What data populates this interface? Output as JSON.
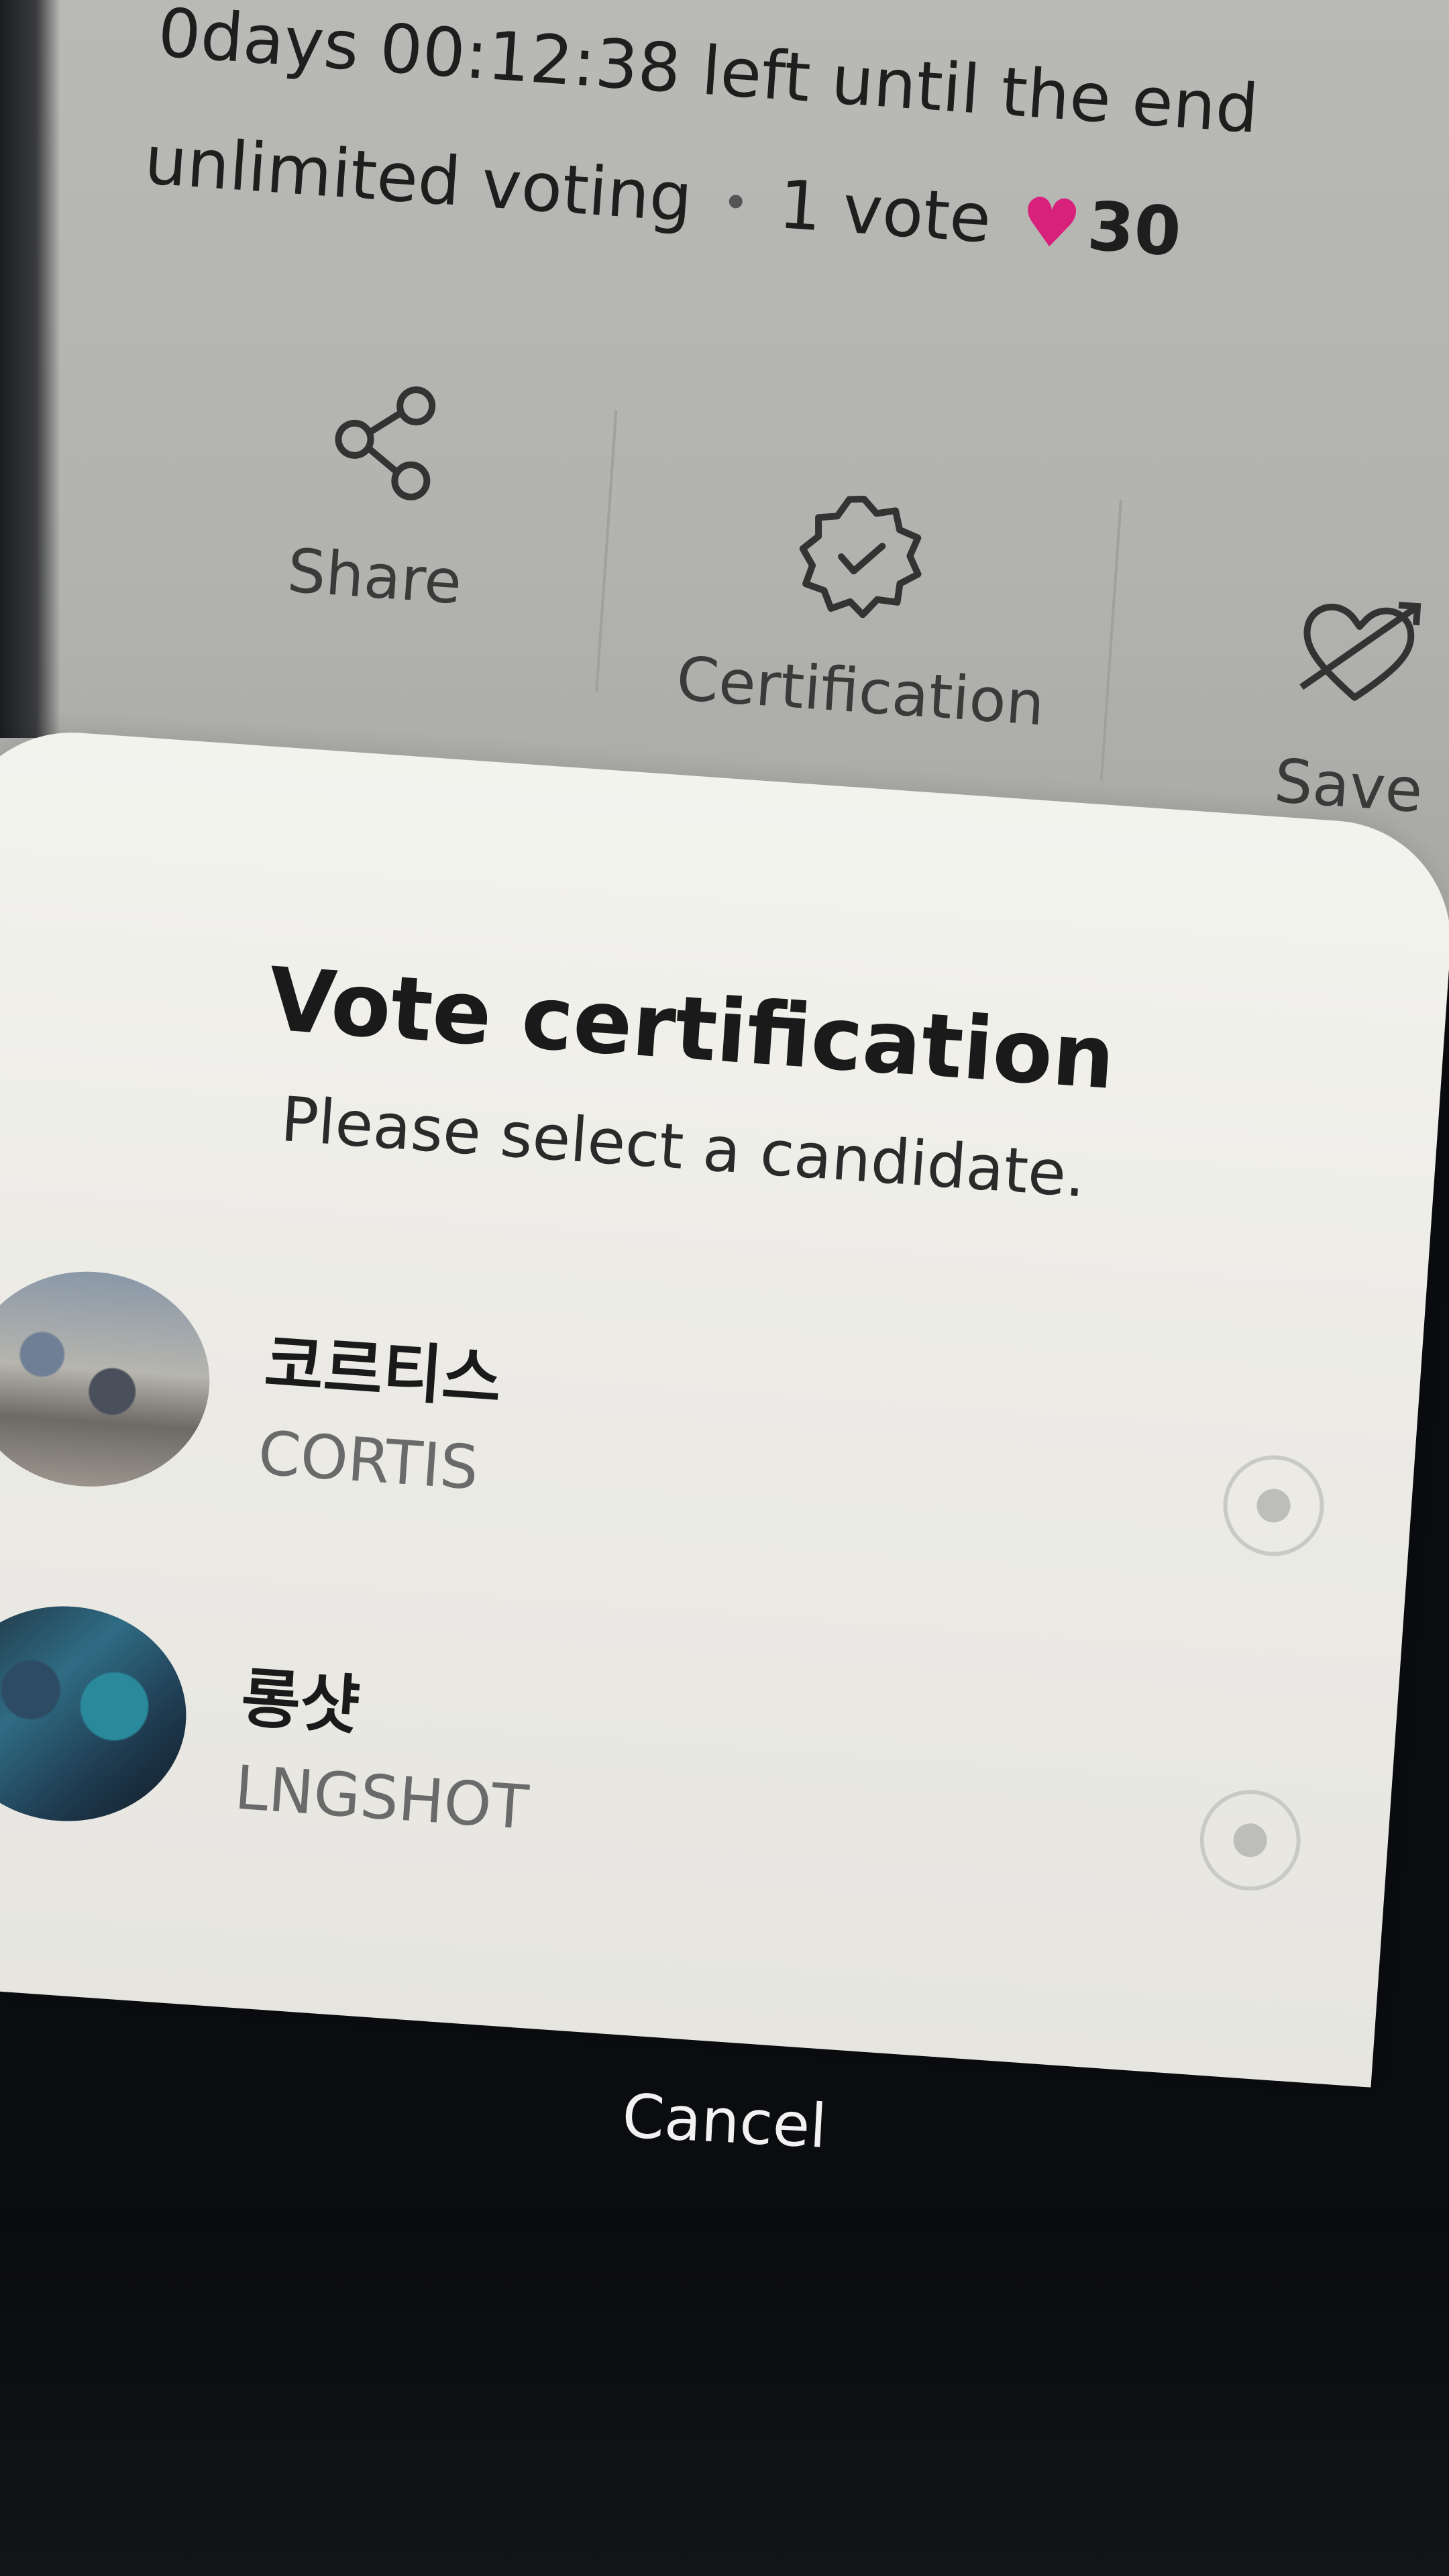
{
  "header": {
    "countdown_text": "0days 00:12:38 left until the end",
    "voting_type": "unlimited voting",
    "vote_count": "1 vote",
    "heart_icon": "heart-icon",
    "heart_color": "#d8217a",
    "heart_count": "30"
  },
  "actions": {
    "share": {
      "label": "Share",
      "icon": "share-icon"
    },
    "certification": {
      "label": "Certification",
      "icon": "badge-check-icon"
    },
    "save": {
      "label": "Save",
      "icon": "heart-arrow-icon"
    }
  },
  "sheet": {
    "title": "Vote certification",
    "subtitle": "Please select a candidate.",
    "candidates": [
      {
        "name_ko": "코르티스",
        "name_en": "CORTIS",
        "selected": false
      },
      {
        "name_ko": "롱샷",
        "name_en": "LNGSHOT",
        "selected": false
      }
    ]
  },
  "footer": {
    "cancel_label": "Cancel"
  }
}
